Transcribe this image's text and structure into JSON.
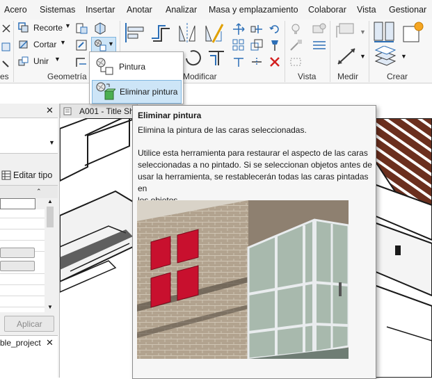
{
  "menubar": {
    "items": [
      "Acero",
      "Sistemas",
      "Insertar",
      "Anotar",
      "Analizar",
      "Masa y emplazamiento",
      "Colaborar",
      "Vista",
      "Gestionar"
    ]
  },
  "ribbon": {
    "geometry": {
      "recorte_label": "Recorte",
      "cortar_label": "Cortar",
      "unir_label": "Unir",
      "panel_label": "Geometría",
      "left_partial_label": "es"
    },
    "modify_panel_label": "Modificar",
    "view_panel_label": "Vista",
    "measure_panel_label": "Medir",
    "create_panel_label": "Crear"
  },
  "paint_dropdown": {
    "items": [
      {
        "label": "Pintura",
        "icon": "paint-icon"
      },
      {
        "label": "Eliminar pintura",
        "icon": "remove-paint-icon",
        "selected": true
      }
    ]
  },
  "left_panel": {
    "edit_type_label": "Editar tipo",
    "apply_label": "Aplicar",
    "project_browser_label": "ble_project",
    "close_glyph": "✕"
  },
  "view_tab": {
    "label": "A001 - Title Sh"
  },
  "tooltip": {
    "title": "Eliminar pintura",
    "description": "Elimina la pintura de las caras seleccionadas.",
    "body_lines": [
      "Utilice esta herramienta para restaurar el aspecto de las caras",
      "seleccionadas a no pintado. Si se seleccionan objetos antes de",
      "usar la herramienta, se restablecerán todas las caras pintadas en",
      "los objetos."
    ],
    "image_colors": {
      "brick": "#b2a38f",
      "mortar": "#cfc4b3",
      "red": "#c8102e",
      "glass": "#a8b9ad",
      "frame": "#e9ecee"
    }
  },
  "colors": {
    "accent_blue": "#2c6fb7",
    "delete_red": "#d32020",
    "hatch_brown": "#6b2f1e"
  }
}
